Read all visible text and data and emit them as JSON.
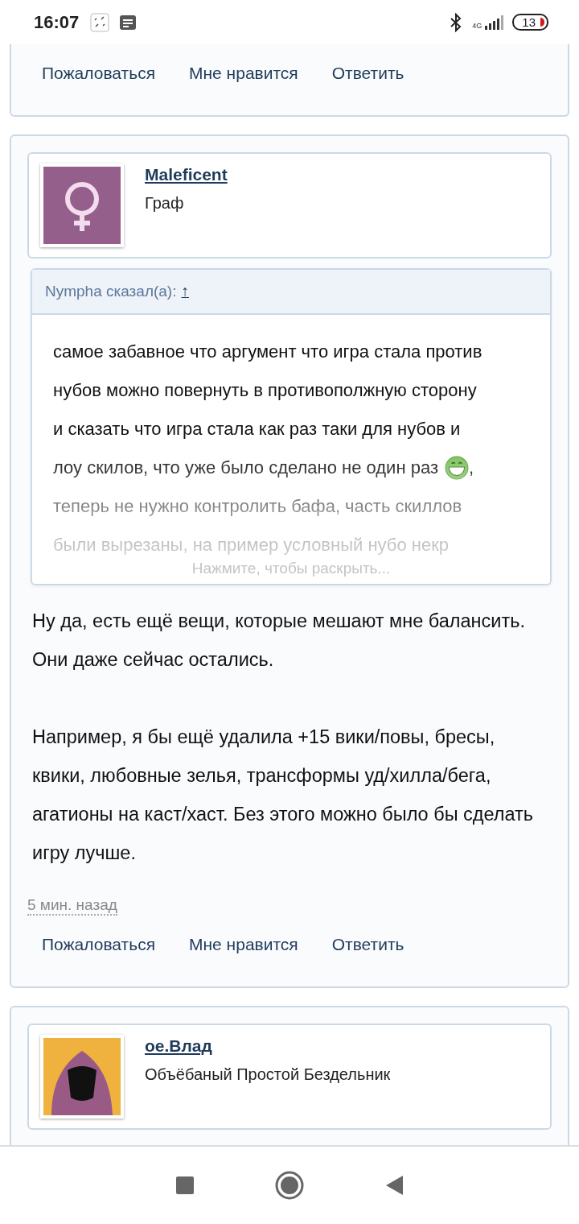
{
  "status_bar": {
    "time": "16:07",
    "network": "4G",
    "battery": "13"
  },
  "previous_post": {
    "actions": [
      "Пожаловаться",
      "Мне нравится",
      "Ответить"
    ]
  },
  "post": {
    "author": "Maleficent",
    "user_title": "Граф",
    "quote": {
      "header": "Nympha сказал(а):",
      "jump_link": "↑",
      "lines": [
        {
          "text": "самое забавное что аргумент что игра стала против"
        },
        {
          "text": "нубов можно повернуть в противополжную сторону"
        },
        {
          "text": "и сказать что игра стала как раз таки для нубов и"
        },
        {
          "text": "лоу скилов, что уже было сделано не один раз",
          "after_emoji": ","
        },
        {
          "text": "теперь не нужно контролить бафа, часть скиллов"
        },
        {
          "text": "были вырезаны, на пример условный нубо некр"
        }
      ],
      "expand": "Нажмите, чтобы раскрыть..."
    },
    "body": [
      "Ну да, есть ещё вещи, которые мешают мне балансить. Они даже сейчас остались.",
      "Например, я бы ещё удалила +15 вики/повы, бресы, квики, любовные зелья, трансформы уд/хилла/бега, агатионы на каст/хаст. Без этого можно было бы сделать игру лучше."
    ],
    "time": "5 мин. назад",
    "actions": [
      "Пожаловаться",
      "Мне нравится",
      "Ответить"
    ]
  },
  "next_post": {
    "author": "ое.Влад",
    "user_title": "Объёбаный Простой Бездельник"
  }
}
